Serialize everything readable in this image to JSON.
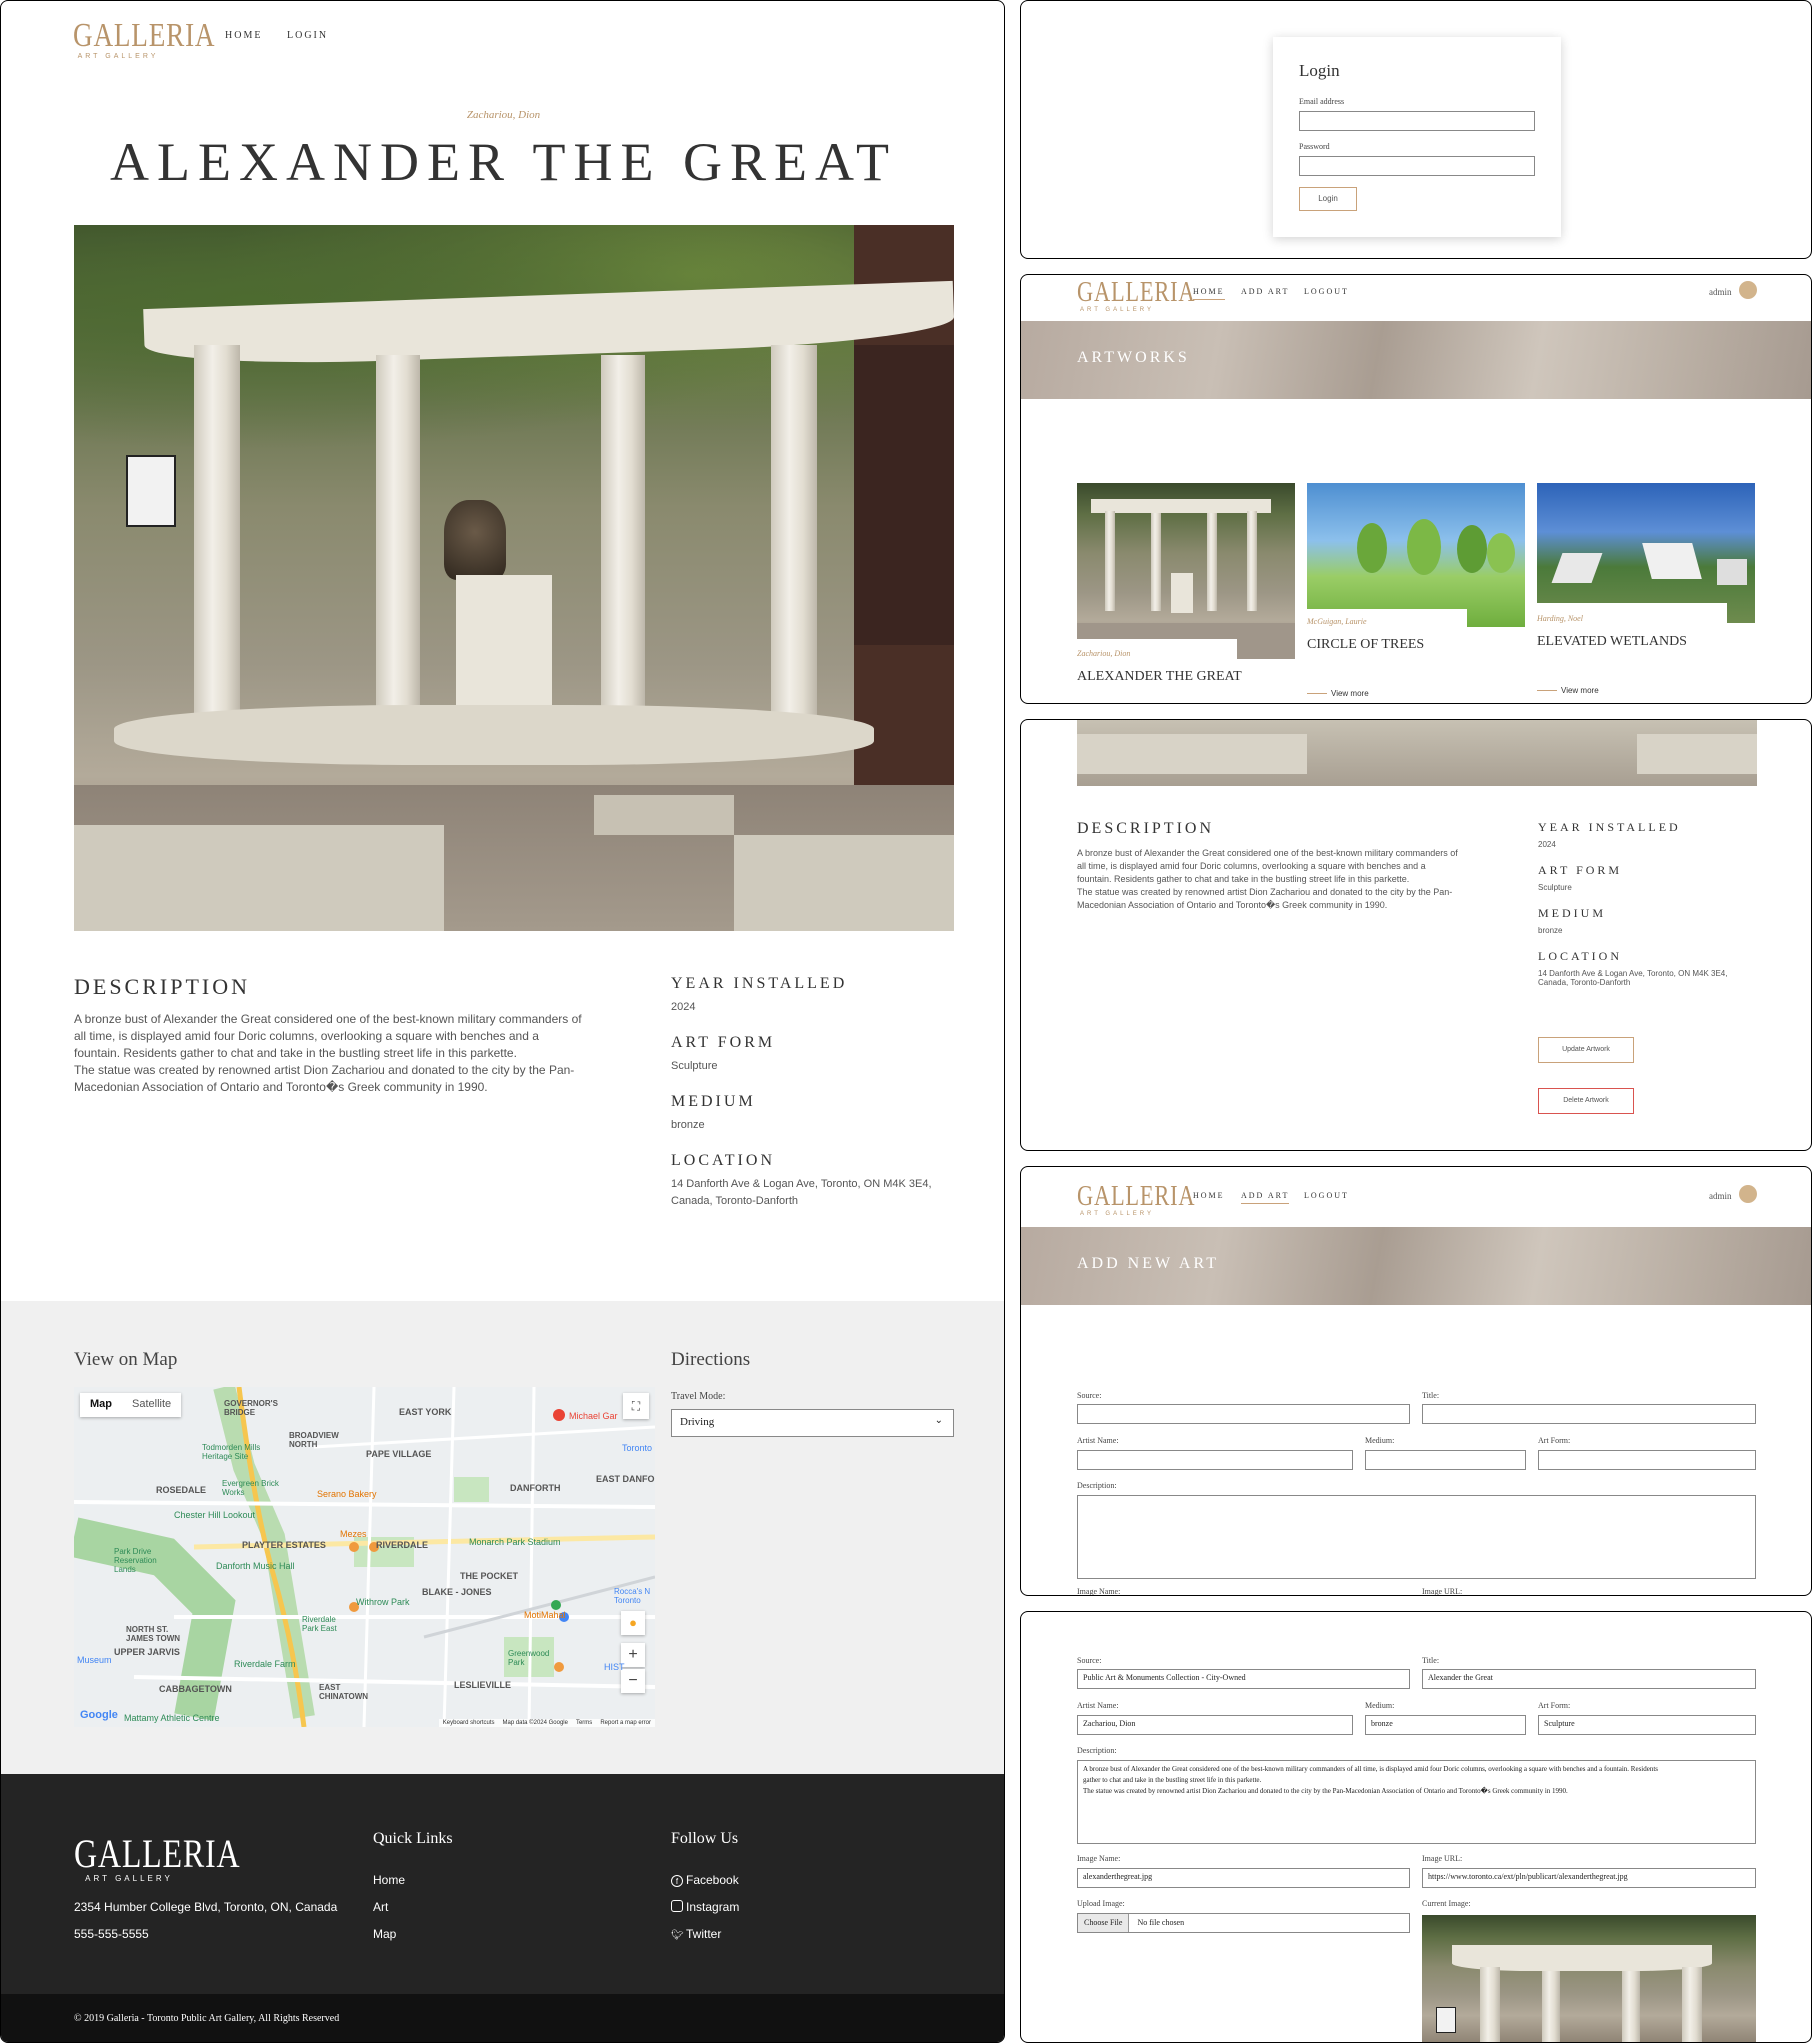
{
  "main": {
    "logo": {
      "name": "GALLERIA",
      "tagline": "ART GALLERY"
    },
    "nav": [
      "HOME",
      "LOGIN"
    ],
    "artist": "Zachariou, Dion",
    "title": "ALEXANDER THE GREAT",
    "description_heading": "DESCRIPTION",
    "description_lines": [
      "A bronze bust of Alexander the Great considered one of the best-known military commanders of",
      "all time, is displayed amid four Doric columns, overlooking a square with benches and a",
      "fountain. Residents gather to chat and take in the bustling street life in this parkette.",
      "The statue was created by renowned artist Dion Zachariou and donated to the city by the Pan-",
      "Macedonian Association of Ontario and Toronto�s Greek community in 1990."
    ],
    "details": [
      {
        "label": "YEAR INSTALLED",
        "value": "2024"
      },
      {
        "label": "ART FORM",
        "value": "Sculpture"
      },
      {
        "label": "MEDIUM",
        "value": "bronze"
      },
      {
        "label": "LOCATION",
        "value": "14 Danforth Ave & Logan Ave, Toronto, ON M4K 3E4,",
        "value2": "Canada, Toronto-Danforth"
      }
    ],
    "map": {
      "heading": "View on Map",
      "tabs": [
        "Map",
        "Satellite"
      ],
      "labels": [
        "GOVERNOR'S BRIDGE",
        "EAST YORK",
        "Michael Gar",
        "BROADVIEW NORTH",
        "PAPE VILLAGE",
        "Todmorden Mills Heritage Site",
        "Toronto",
        "ROSEDALE",
        "Evergreen Brick Works",
        "Serano Bakery",
        "DANFORTH",
        "EAST DANFO",
        "Chester Hill Lookout",
        "Park Drive Reservation Lands",
        "Mezes",
        "Monarch Park Stadium",
        "PLAYTER ESTATES",
        "RIVERDALE",
        "Danforth Music Hall",
        "THE POCKET",
        "BLAKE - JONES",
        "Withrow Park",
        "Rocca's N Toronto",
        "MotiMahal",
        "Riverdale Park East",
        "NORTH ST. JAMES TOWN",
        "UPPER JARVIS",
        "Museum",
        "Riverdale Farm",
        "Greenwood Park",
        "CABBAGETOWN",
        "EAST CHINATOWN",
        "LESLIEVILLE",
        "Mattamy Athletic Centre",
        "HIST"
      ],
      "footer": [
        "Keyboard shortcuts",
        "Map data ©2024 Google",
        "Terms",
        "Report a map error"
      ],
      "google": "Google"
    },
    "directions": {
      "heading": "Directions",
      "label": "Travel Mode:",
      "value": "Driving"
    },
    "footer": {
      "address": "2354 Humber College Blvd, Toronto, ON, Canada",
      "phone": "555-555-5555",
      "quick_heading": "Quick Links",
      "quick_links": [
        "Home",
        "Art",
        "Map"
      ],
      "follow_heading": "Follow Us",
      "social": [
        "Facebook",
        "Instagram",
        "Twitter"
      ],
      "copyright": "© 2019 Galleria - Toronto Public Art Gallery, All Rights Reserved"
    }
  },
  "login": {
    "title": "Login",
    "email_label": "Email address",
    "password_label": "Password",
    "button": "Login"
  },
  "artworks": {
    "nav": [
      "HOME",
      "ADD ART",
      "LOGOUT"
    ],
    "user": "admin",
    "banner": "ARTWORKS",
    "cards": [
      {
        "artist": "Zachariou, Dion",
        "title": "ALEXANDER THE GREAT",
        "more": ""
      },
      {
        "artist": "McGuigan, Laurie",
        "title": "CIRCLE OF TREES",
        "more": "View more"
      },
      {
        "artist": "Harding, Noel",
        "title": "ELEVATED WETLANDS",
        "more": "View more"
      }
    ]
  },
  "detail_admin": {
    "description_heading": "DESCRIPTION",
    "description_lines": [
      "A bronze bust of Alexander the Great considered one of the best-known military commanders of",
      "all time, is displayed amid four Doric columns, overlooking a square with benches and a",
      "fountain. Residents gather to chat and take in the bustling street life in this parkette.",
      "The statue was created by renowned artist Dion Zachariou and donated to the city by the Pan-",
      "Macedonian Association of Ontario and Toronto�s Greek community in 1990."
    ],
    "details": [
      {
        "label": "YEAR INSTALLED",
        "value": "2024"
      },
      {
        "label": "ART FORM",
        "value": "Sculpture"
      },
      {
        "label": "MEDIUM",
        "value": "bronze"
      },
      {
        "label": "LOCATION",
        "value": "14 Danforth Ave & Logan Ave, Toronto, ON M4K 3E4,",
        "value2": "Canada, Toronto-Danforth"
      }
    ],
    "update_button": "Update Artwork",
    "delete_button": "Delete Artwork"
  },
  "add_art": {
    "nav": [
      "HOME",
      "ADD ART",
      "LOGOUT"
    ],
    "user": "admin",
    "banner": "ADD NEW ART",
    "labels": {
      "source": "Source:",
      "title": "Title:",
      "artist": "Artist Name:",
      "medium": "Medium:",
      "art_form": "Art Form:",
      "description": "Description:",
      "image_name": "Image Name:",
      "image_url": "Image URL:"
    }
  },
  "edit_art": {
    "labels": {
      "source": "Source:",
      "title": "Title:",
      "artist": "Artist Name:",
      "medium": "Medium:",
      "art_form": "Art Form:",
      "description": "Description:",
      "image_name": "Image Name:",
      "image_url": "Image URL:",
      "upload": "Upload Image:",
      "current": "Current Image:"
    },
    "values": {
      "source": "Public Art & Monuments Collection - City-Owned",
      "title": "Alexander the Great",
      "artist": "Zachariou, Dion",
      "medium": "bronze",
      "art_form": "Sculpture",
      "description1": "A bronze bust of Alexander the Great considered one of the best-known military commanders of all time, is displayed amid four Doric columns, overlooking a square with benches and a fountain. Residents",
      "description2": "gather to chat and take in the bustling street life in this parkette.",
      "description3": "The statue was created by renowned artist Dion Zachariou and donated to the city by the Pan-Macedonian Association of Ontario and Toronto�s Greek community in 1990.",
      "image_name": "alexanderthegreat.jpg",
      "image_url": "https://www.toronto.ca/ext/pln/publicart/alexanderthegreat.jpg",
      "choose_file": "Choose File",
      "no_file": "No file chosen"
    }
  }
}
